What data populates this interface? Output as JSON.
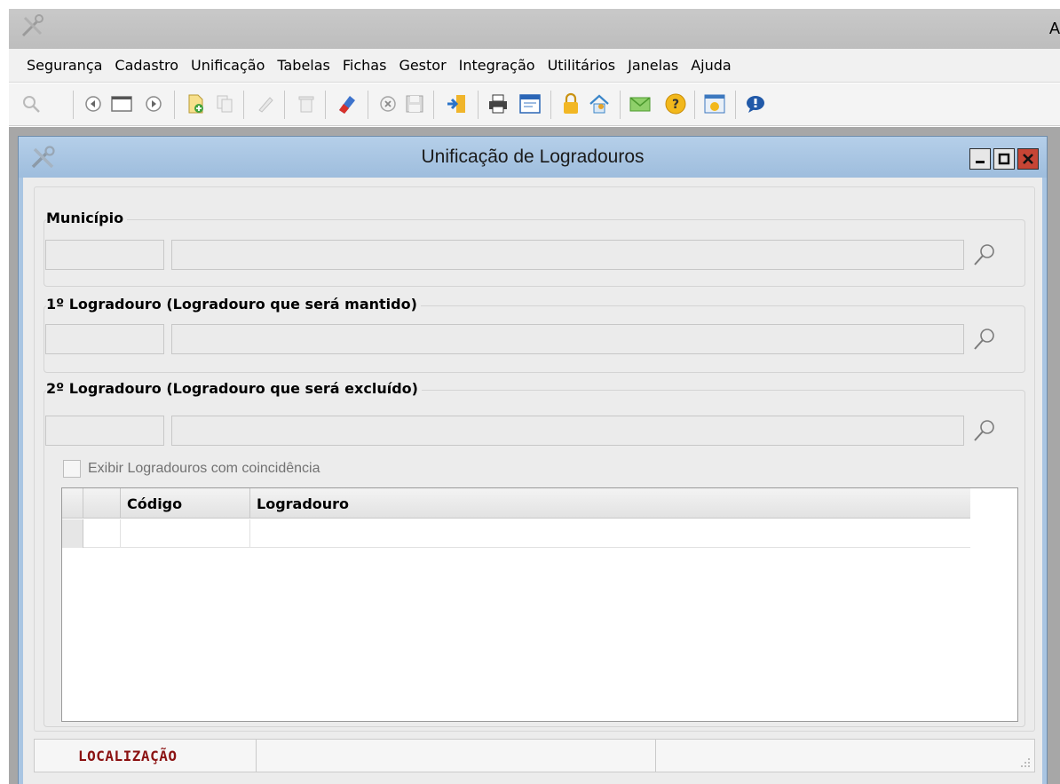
{
  "app": {
    "title_fragment": "A"
  },
  "menu": [
    {
      "label": "Segurança"
    },
    {
      "label": "Cadastro"
    },
    {
      "label": "Unificação"
    },
    {
      "label": "Tabelas"
    },
    {
      "label": "Fichas"
    },
    {
      "label": "Gestor"
    },
    {
      "label": "Integração"
    },
    {
      "label": "Utilitários"
    },
    {
      "label": "Janelas"
    },
    {
      "label": "Ajuda"
    }
  ],
  "toolbar": {
    "icons": [
      "search-icon",
      "prev-record-icon",
      "record-frame-icon",
      "next-record-icon",
      "new-record-icon",
      "copy-icon",
      "edit-icon",
      "delete-icon",
      "eraser-icon",
      "cancel-icon",
      "save-icon",
      "import-icon",
      "print-icon",
      "report-icon",
      "lock-icon",
      "home-icon",
      "mail-icon",
      "help-icon",
      "about-icon",
      "message-icon"
    ]
  },
  "window": {
    "title": "Unificação de Logradouros",
    "controls": [
      "minimize-icon",
      "maximize-icon",
      "close-icon"
    ]
  },
  "form": {
    "municipio": {
      "title": "Município",
      "code": "",
      "name": ""
    },
    "logradouro1": {
      "title": "1º Logradouro (Logradouro que será mantido)",
      "code": "",
      "name": ""
    },
    "logradouro2": {
      "title": "2º Logradouro (Logradouro que será excluído)",
      "code": "",
      "name": ""
    },
    "show_matches": {
      "label": "Exibir Logradouros com coincidência",
      "checked": false
    }
  },
  "grid": {
    "columns": [
      "",
      "",
      "Código",
      "Logradouro"
    ],
    "rows": [
      {
        "codigo": "",
        "logradouro": ""
      }
    ]
  },
  "status": {
    "label": "LOCALIZAÇÃO",
    "cell2": "",
    "cell3": ""
  },
  "colors": {
    "window_title_bg": "#a9c5e2",
    "status_text": "#8b1212",
    "close_button": "#c74535"
  }
}
